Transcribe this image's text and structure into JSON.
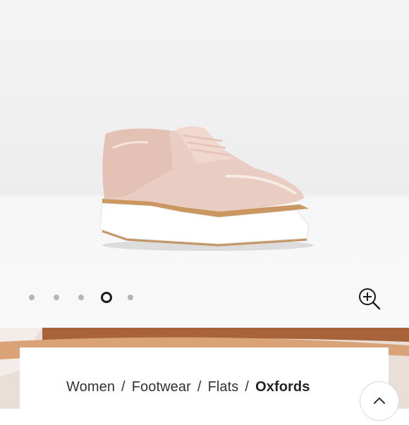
{
  "carousel": {
    "slide_count": 5,
    "active_index": 3
  },
  "icons": {
    "zoom": "zoom-in-icon",
    "scroll_top": "chevron-up-icon"
  },
  "breadcrumb": {
    "items": [
      "Women",
      "Footwear",
      "Flats"
    ],
    "current": "Oxfords",
    "separator": "/"
  },
  "colors": {
    "accent": "#1b1b1b",
    "dot_inactive": "#b5b5b5",
    "background": "#f4f4f4"
  }
}
